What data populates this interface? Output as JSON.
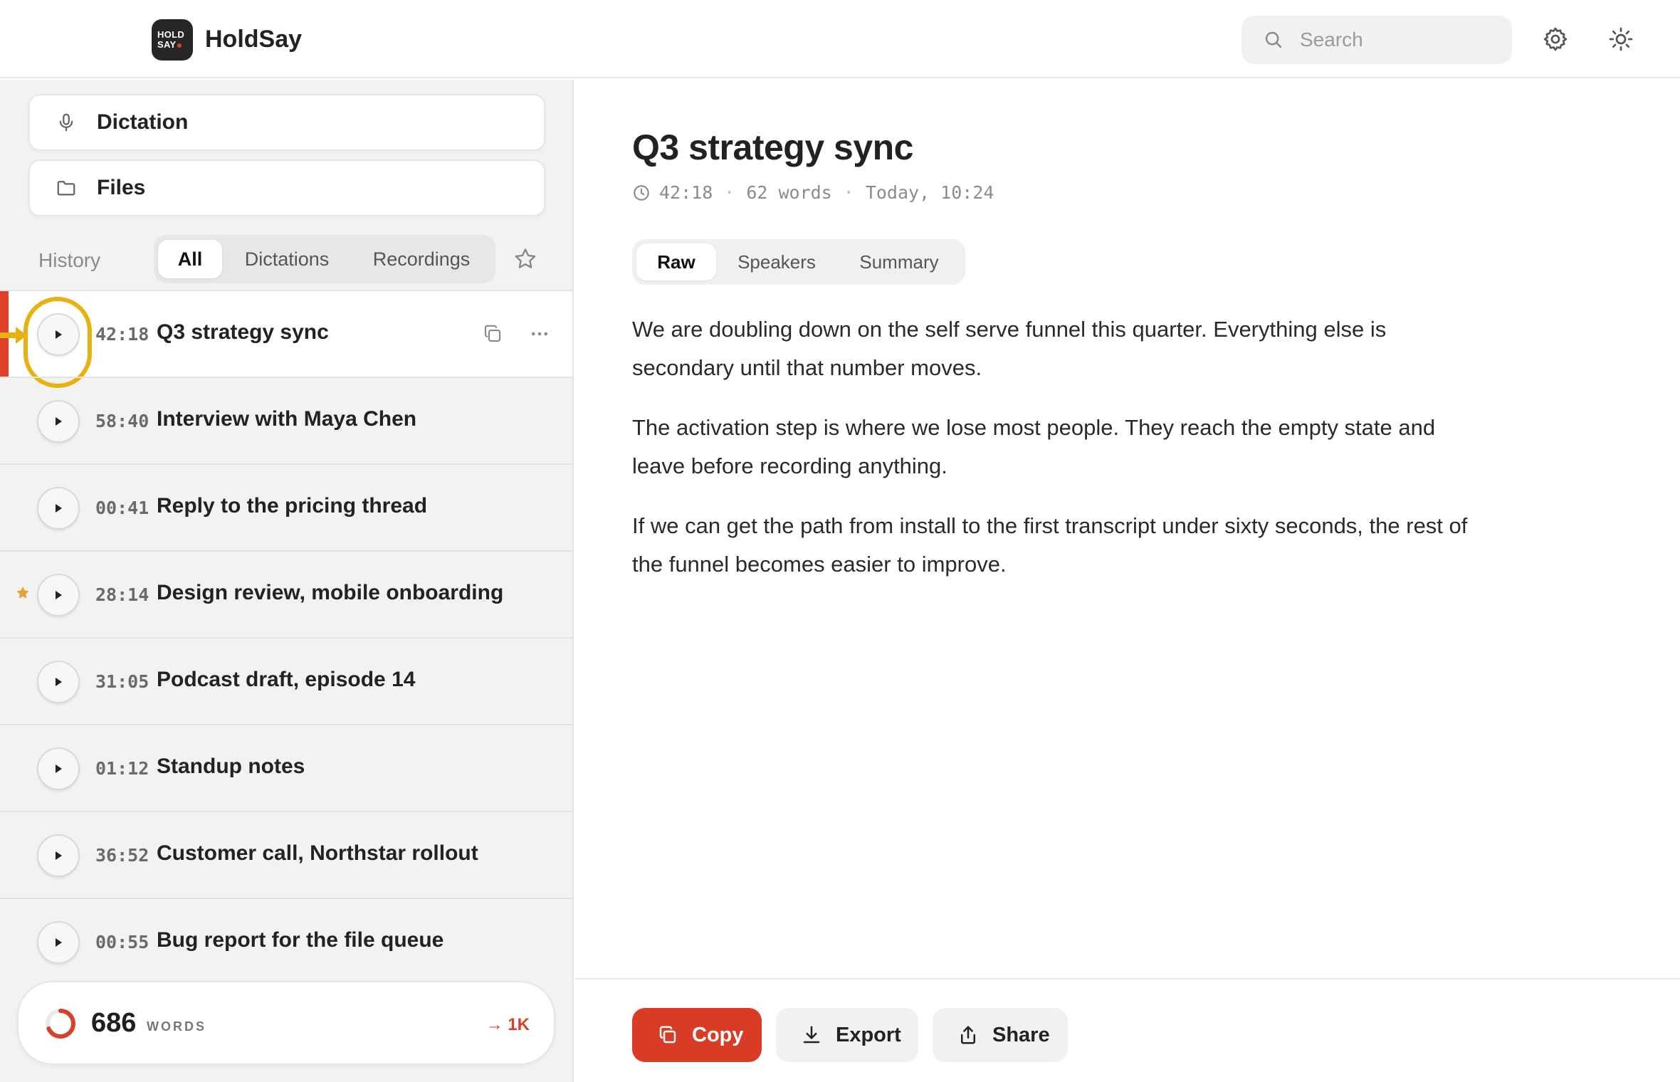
{
  "app": {
    "name": "HoldSay",
    "logo_line1": "HOLD",
    "logo_line2": "SAY"
  },
  "search": {
    "placeholder": "Search"
  },
  "sidebar": {
    "nav": [
      {
        "label": "Dictation",
        "icon": "microphone-icon"
      },
      {
        "label": "Files",
        "icon": "folder-icon"
      }
    ],
    "history_label": "History",
    "filters": [
      "All",
      "Dictations",
      "Recordings"
    ],
    "active_filter": "All",
    "items": [
      {
        "duration": "42:18",
        "title": "Q3 strategy sync",
        "active": true,
        "starred": false
      },
      {
        "duration": "58:40",
        "title": "Interview with Maya Chen",
        "active": false,
        "starred": false
      },
      {
        "duration": "00:41",
        "title": "Reply to the pricing thread",
        "active": false,
        "starred": false
      },
      {
        "duration": "28:14",
        "title": "Design review, mobile onboarding",
        "active": false,
        "starred": true
      },
      {
        "duration": "31:05",
        "title": "Podcast draft, episode 14",
        "active": false,
        "starred": false
      },
      {
        "duration": "01:12",
        "title": "Standup notes",
        "active": false,
        "starred": false
      },
      {
        "duration": "36:52",
        "title": "Customer call, Northstar rollout",
        "active": false,
        "starred": false
      },
      {
        "duration": "00:55",
        "title": "Bug report for the file queue",
        "active": false,
        "starred": false
      }
    ],
    "word_count": {
      "count": "686",
      "unit": "WORDS",
      "goal": "→ 1K",
      "progress": 0.686
    }
  },
  "document": {
    "title": "Q3 strategy sync",
    "meta": {
      "duration": "42:18",
      "words": "62 words",
      "date": "Today, 10:24"
    },
    "tabs": [
      "Raw",
      "Speakers",
      "Summary"
    ],
    "active_tab": "Raw",
    "paragraphs": [
      "We are doubling down on the self serve funnel this quarter. Everything else is secondary until that number moves.",
      "The activation step is where we lose most people. They reach the empty state and leave before recording anything.",
      "If we can get the path from install to the first transcript under sixty seconds, the rest of the funnel becomes easier to improve."
    ]
  },
  "actions": {
    "copy": "Copy",
    "export": "Export",
    "share": "Share"
  },
  "colors": {
    "accent": "#d83b26",
    "focus": "#e9b10f",
    "star": "#e2a23a"
  }
}
